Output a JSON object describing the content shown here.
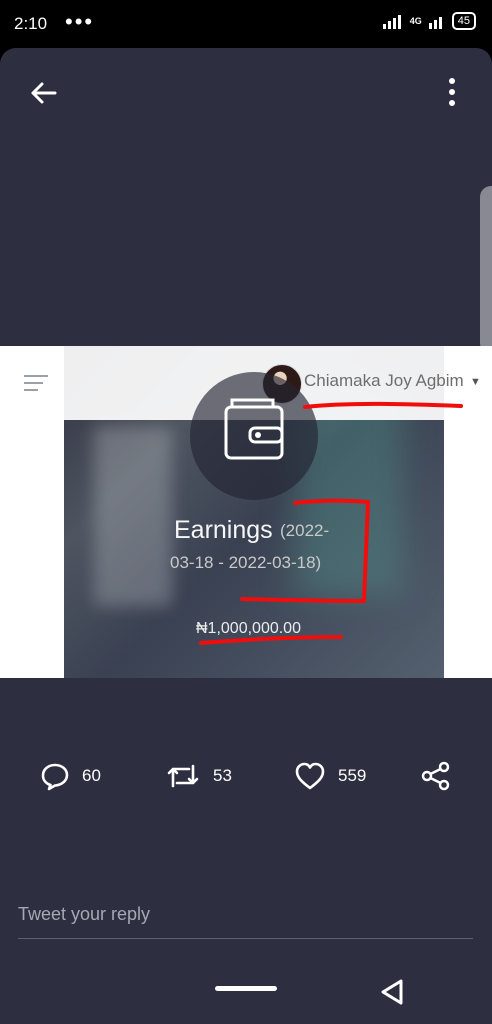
{
  "status_bar": {
    "time": "2:10",
    "network": "4G",
    "battery": "45"
  },
  "tweet_media": {
    "profile_name": "Chiamaka Joy Agbim",
    "earnings_title": "Earnings",
    "date_line1": "(2022-",
    "date_line2": "03-18 - 2022-03-18)",
    "amount": "₦1,000,000.00"
  },
  "actions": {
    "replies": "60",
    "retweets": "53",
    "likes": "559"
  },
  "reply": {
    "placeholder": "Tweet your reply"
  },
  "colors": {
    "background": "#2d2e40",
    "status_bar": "#000000",
    "annotation_red": "#f20d0d"
  },
  "icons": [
    "back-arrow-icon",
    "more-vertical-icon",
    "hamburger-menu-icon",
    "wallet-icon",
    "reply-icon",
    "retweet-icon",
    "heart-icon",
    "share-icon",
    "home-pill-icon",
    "back-triangle-icon"
  ]
}
